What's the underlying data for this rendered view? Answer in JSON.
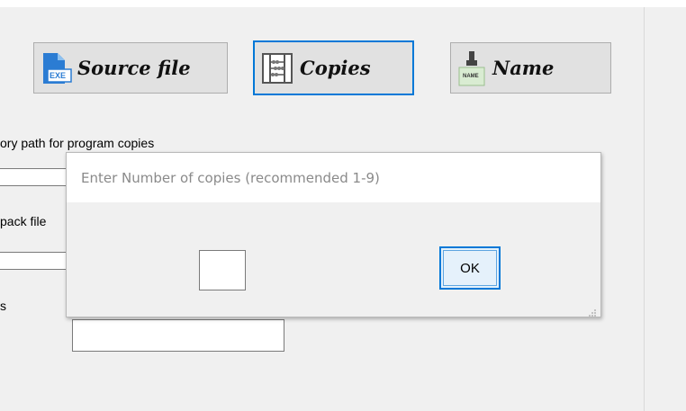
{
  "toolbar": {
    "source_file_label": "Source file",
    "copies_label": "Copies",
    "name_label": "Name",
    "exe_badge": "EXE",
    "name_tag_text": "NAME"
  },
  "form": {
    "directory_path_label": "ory path for program copies",
    "pack_file_label": "pack file",
    "third_label": "s"
  },
  "dialog": {
    "prompt": "Enter Number of copies (recommended 1-9)",
    "copies_value": "",
    "ok_label": "OK"
  },
  "colors": {
    "accent": "#0078d7",
    "background": "#f0f0f0",
    "button_face": "#e1e1e1"
  }
}
